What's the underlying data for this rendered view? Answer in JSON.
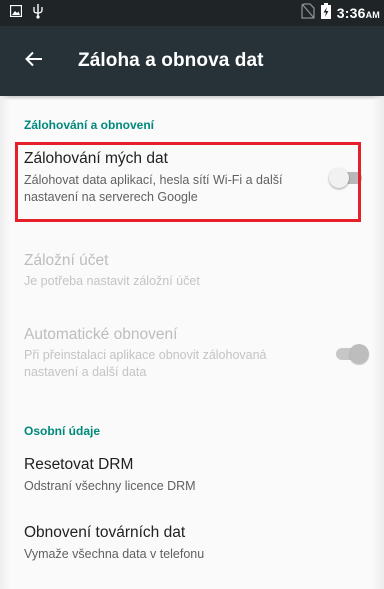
{
  "statusbar": {
    "time": "3:36",
    "ampm": "AM",
    "icons": [
      "screenshot-icon",
      "usb-icon",
      "no-sim-icon",
      "battery-charging-icon"
    ]
  },
  "appbar": {
    "back_icon": "arrow-left-icon",
    "title": "Záloha a obnova dat"
  },
  "sections": {
    "backup": {
      "header": "Zálohování a obnovení",
      "backup_data": {
        "title": "Zálohování mých dat",
        "summary": "Zálohovat data aplikací, hesla sítí Wi-Fi a další nastavení na serverech Google",
        "toggle_state": "off"
      },
      "backup_account": {
        "title": "Záložní účet",
        "summary": "Je potřeba nastavit záložní účet"
      },
      "auto_restore": {
        "title": "Automatické obnovení",
        "summary": "Při přeinstalaci aplikace obnovit zálohovaná nastavení a další data",
        "toggle_state": "on-disabled"
      }
    },
    "personal": {
      "header": "Osobní údaje",
      "reset_drm": {
        "title": "Resetovat DRM",
        "summary": "Odstraní všechny licence DRM"
      },
      "factory_reset": {
        "title": "Obnovení továrních dat",
        "summary": "Vymaže všechna data v telefonu"
      }
    }
  },
  "colors": {
    "statusbar": "#1f2527",
    "appbar": "#263238",
    "accent": "#00897b",
    "highlight": "#e5202a"
  }
}
